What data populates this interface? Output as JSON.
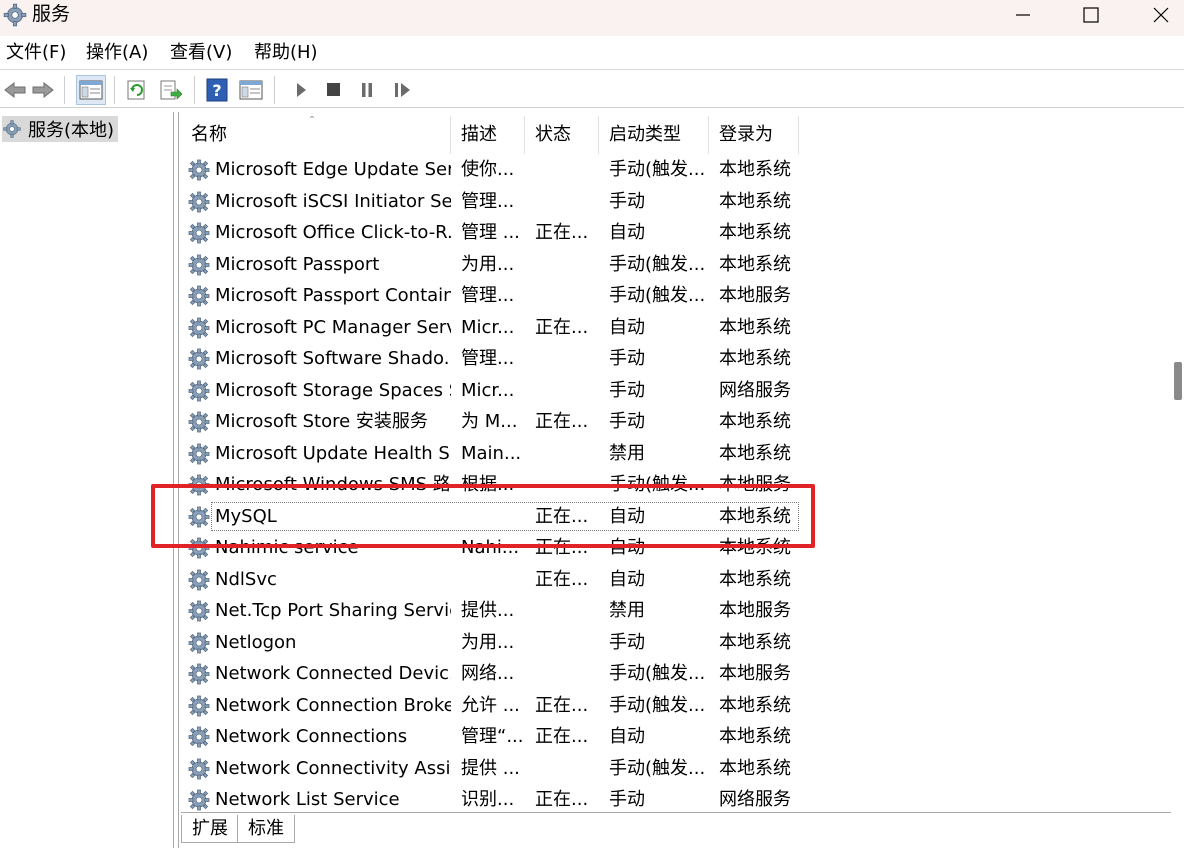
{
  "window": {
    "title": "服务"
  },
  "menu": [
    "文件(F)",
    "操作(A)",
    "查看(V)",
    "帮助(H)"
  ],
  "tree": {
    "root_label": "服务(本地)"
  },
  "columns": {
    "name": "名称",
    "desc": "描述",
    "status": "状态",
    "startup": "启动类型",
    "logon": "登录为"
  },
  "services": [
    {
      "name": "Microsoft Edge Update Ser...",
      "desc": "使你...",
      "status": "",
      "startup": "手动(触发...",
      "logon": "本地系统"
    },
    {
      "name": "Microsoft iSCSI Initiator Ser...",
      "desc": "管理...",
      "status": "",
      "startup": "手动",
      "logon": "本地系统"
    },
    {
      "name": "Microsoft Office Click-to-R...",
      "desc": "管理 ...",
      "status": "正在...",
      "startup": "自动",
      "logon": "本地系统"
    },
    {
      "name": "Microsoft Passport",
      "desc": "为用...",
      "status": "",
      "startup": "手动(触发...",
      "logon": "本地系统"
    },
    {
      "name": "Microsoft Passport Container",
      "desc": "管理...",
      "status": "",
      "startup": "手动(触发...",
      "logon": "本地服务"
    },
    {
      "name": "Microsoft PC Manager Serv...",
      "desc": "Micr...",
      "status": "正在...",
      "startup": "自动",
      "logon": "本地系统"
    },
    {
      "name": "Microsoft Software Shado...",
      "desc": "管理...",
      "status": "",
      "startup": "手动",
      "logon": "本地系统"
    },
    {
      "name": "Microsoft Storage Spaces S...",
      "desc": "Micr...",
      "status": "",
      "startup": "手动",
      "logon": "网络服务"
    },
    {
      "name": "Microsoft Store 安装服务",
      "desc": "为 M...",
      "status": "正在...",
      "startup": "手动",
      "logon": "本地系统"
    },
    {
      "name": "Microsoft Update Health S...",
      "desc": "Main...",
      "status": "",
      "startup": "禁用",
      "logon": "本地系统"
    },
    {
      "name": "Microsoft Windows SMS 路...",
      "desc": "根据...",
      "status": "",
      "startup": "手动(触发...",
      "logon": "本地服务"
    },
    {
      "name": "MySQL",
      "desc": "",
      "status": "正在...",
      "startup": "自动",
      "logon": "本地系统"
    },
    {
      "name": "Nahimic service",
      "desc": "Nahi...",
      "status": "正在...",
      "startup": "自动",
      "logon": "本地系统"
    },
    {
      "name": "NdlSvc",
      "desc": "",
      "status": "正在...",
      "startup": "自动",
      "logon": "本地系统"
    },
    {
      "name": "Net.Tcp Port Sharing Service",
      "desc": "提供...",
      "status": "",
      "startup": "禁用",
      "logon": "本地服务"
    },
    {
      "name": "Netlogon",
      "desc": "为用...",
      "status": "",
      "startup": "手动",
      "logon": "本地系统"
    },
    {
      "name": "Network Connected Devic...",
      "desc": "网络...",
      "status": "",
      "startup": "手动(触发...",
      "logon": "本地服务"
    },
    {
      "name": "Network Connection Broker",
      "desc": "允许 ...",
      "status": "正在...",
      "startup": "手动(触发...",
      "logon": "本地系统"
    },
    {
      "name": "Network Connections",
      "desc": "管理“...",
      "status": "正在...",
      "startup": "自动",
      "logon": "本地系统"
    },
    {
      "name": "Network Connectivity Assis...",
      "desc": "提供 ...",
      "status": "",
      "startup": "手动(触发...",
      "logon": "本地系统"
    },
    {
      "name": "Network List Service",
      "desc": "识别...",
      "status": "正在...",
      "startup": "手动",
      "logon": "网络服务"
    }
  ],
  "tabs": [
    "扩展",
    "标准"
  ],
  "colors": {
    "highlight": "#e12327",
    "titlebar": "#f9f2f1"
  }
}
